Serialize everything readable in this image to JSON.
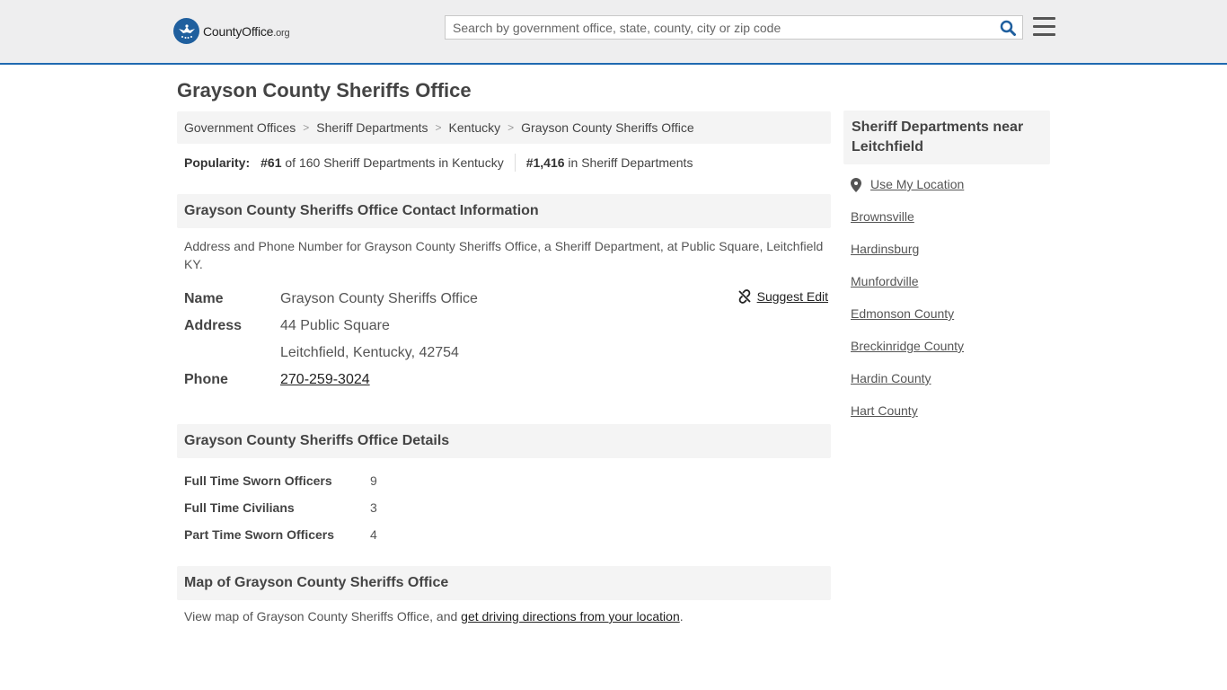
{
  "header": {
    "logo_text": "CountyOffice",
    "logo_domain": ".org",
    "search_placeholder": "Search by government office, state, county, city or zip code",
    "search_icon": "search-icon",
    "menu_icon": "hamburger-menu-icon",
    "accent_color": "#1f6ab1"
  },
  "page": {
    "title": "Grayson County Sheriffs Office"
  },
  "breadcrumb": [
    "Government Offices",
    "Sheriff Departments",
    "Kentucky",
    "Grayson County Sheriffs Office"
  ],
  "popularity": {
    "label": "Popularity:",
    "rank1": "#61",
    "rank1_text": "of 160 Sheriff Departments in Kentucky",
    "rank2": "#1,416",
    "rank2_text": "in Sheriff Departments"
  },
  "contact": {
    "heading": "Grayson County Sheriffs Office Contact Information",
    "description": "Address and Phone Number for Grayson County Sheriffs Office, a Sheriff Department, at Public Square, Leitchfield KY.",
    "suggest_edit": "Suggest Edit",
    "name_label": "Name",
    "name_value": "Grayson County Sheriffs Office",
    "address_label": "Address",
    "address_line1": "44 Public Square",
    "address_line2": "Leitchfield, Kentucky, 42754",
    "phone_label": "Phone",
    "phone_value": "270-259-3024"
  },
  "details": {
    "heading": "Grayson County Sheriffs Office Details",
    "rows": [
      {
        "label": "Full Time Sworn Officers",
        "value": "9"
      },
      {
        "label": "Full Time Civilians",
        "value": "3"
      },
      {
        "label": "Part Time Sworn Officers",
        "value": "4"
      }
    ]
  },
  "map": {
    "heading": "Map of Grayson County Sheriffs Office",
    "text_before": "View map of Grayson County Sheriffs Office, and ",
    "link_text": "get driving directions from your location",
    "text_after": "."
  },
  "sidebar": {
    "heading": "Sheriff Departments near Leitchfield",
    "use_location": "Use My Location",
    "links": [
      "Brownsville",
      "Hardinsburg",
      "Munfordville",
      "Edmonson County",
      "Breckinridge County",
      "Hardin County",
      "Hart County"
    ]
  }
}
